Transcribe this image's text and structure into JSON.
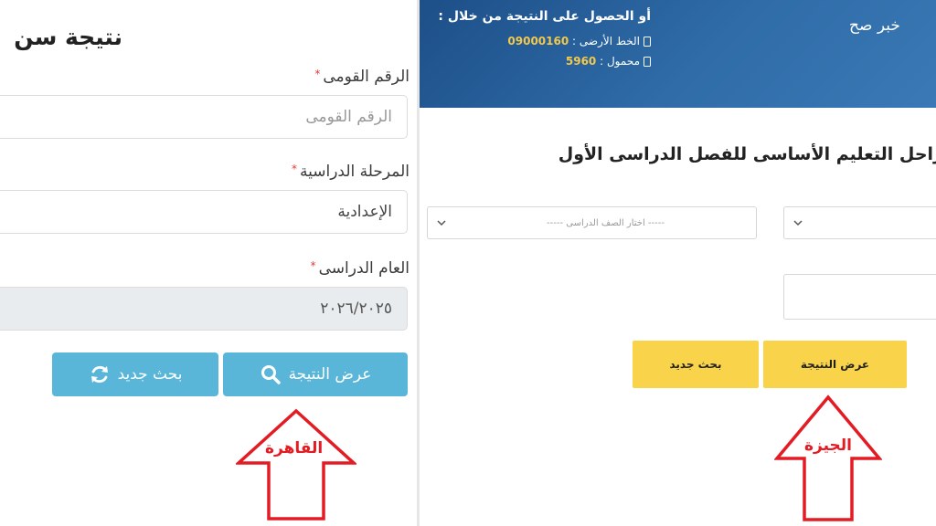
{
  "left": {
    "title": "نتيجة سن",
    "fields": [
      {
        "label": "الرقم القومى",
        "placeholder": "الرقم القومى",
        "value": ""
      },
      {
        "label": "المرحلة الدراسية",
        "value": "الإعدادية"
      },
      {
        "label": "العام الدراسى",
        "value": "٢٠٢٦/٢٠٢٥"
      }
    ],
    "show_result_label": "عرض النتيجة",
    "new_search_label": "بحث جديد",
    "arrow_label": "القاهرة"
  },
  "right": {
    "banner": {
      "heading": "أو الحصول على النتيجة من خلال :",
      "landline_label": "الخط الأرضى :",
      "landline_number": "09000160",
      "mobile_label": "محمول :",
      "mobile_number": "5960"
    },
    "watermark": "خبر صح",
    "section_title": "راحل التعليم الأساسى للفصل الدراسى الأول",
    "select_grade_placeholder": "----- اختار الصف الدراسى -----",
    "show_result_label": "عرض النتيجة",
    "new_search_label": "بحث جديد",
    "arrow_label": "الجيزة"
  },
  "colors": {
    "blue_button": "#5ab6d8",
    "yellow_button": "#f9d44a",
    "banner": "#2f6ca8",
    "arrow": "#e31b23",
    "required": "#e23b3b"
  },
  "icons": [
    "search-icon",
    "refresh-icon",
    "chevron-down-icon",
    "phone-icon",
    "up-arrow"
  ]
}
